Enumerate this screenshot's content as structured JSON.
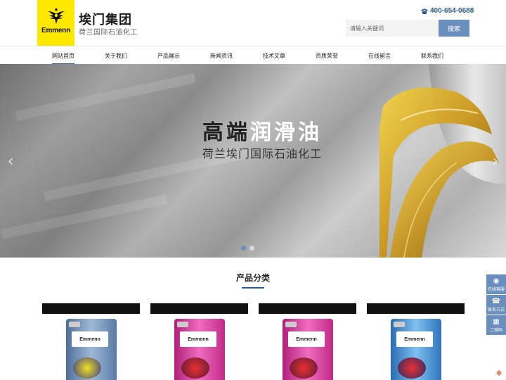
{
  "header": {
    "logo_text": "Emmenn",
    "brand_title": "埃门集团",
    "brand_subtitle": "荷兰国际石油化工",
    "phone": "400-654-0688",
    "search_placeholder": "请输入关键词",
    "search_button": "搜索"
  },
  "nav": {
    "items": [
      {
        "label": "网站首页",
        "active": true
      },
      {
        "label": "关于我们"
      },
      {
        "label": "产品展示"
      },
      {
        "label": "新闻资讯"
      },
      {
        "label": "技术文章"
      },
      {
        "label": "资质荣誉"
      },
      {
        "label": "在线留言"
      },
      {
        "label": "联系我们"
      }
    ]
  },
  "banner": {
    "title_dark": "高端",
    "title_light": "润滑油",
    "subtitle": "荷兰埃门国际石油化工",
    "prev": "‹",
    "next": "›",
    "slides": 2,
    "active_slide": 1
  },
  "products": {
    "title": "产品分类",
    "cards": [
      {
        "brand": "Emmenn",
        "color": "#6f8fb7"
      },
      {
        "brand": "Emmenn",
        "color": "#d6389a"
      },
      {
        "brand": "Emmenn",
        "color": "#d6389a"
      },
      {
        "brand": "Emmenn",
        "color": "#3b82c9"
      }
    ]
  },
  "side_tools": {
    "items": [
      {
        "label": "在线客服",
        "icon": "chat-icon"
      },
      {
        "label": "联系方式",
        "icon": "phone-icon"
      },
      {
        "label": "二维码",
        "icon": "qrcode-icon"
      }
    ]
  },
  "colors": {
    "accent": "#2a5d8f",
    "button": "#6b8fbd",
    "logo_bg": "#ffe800"
  }
}
